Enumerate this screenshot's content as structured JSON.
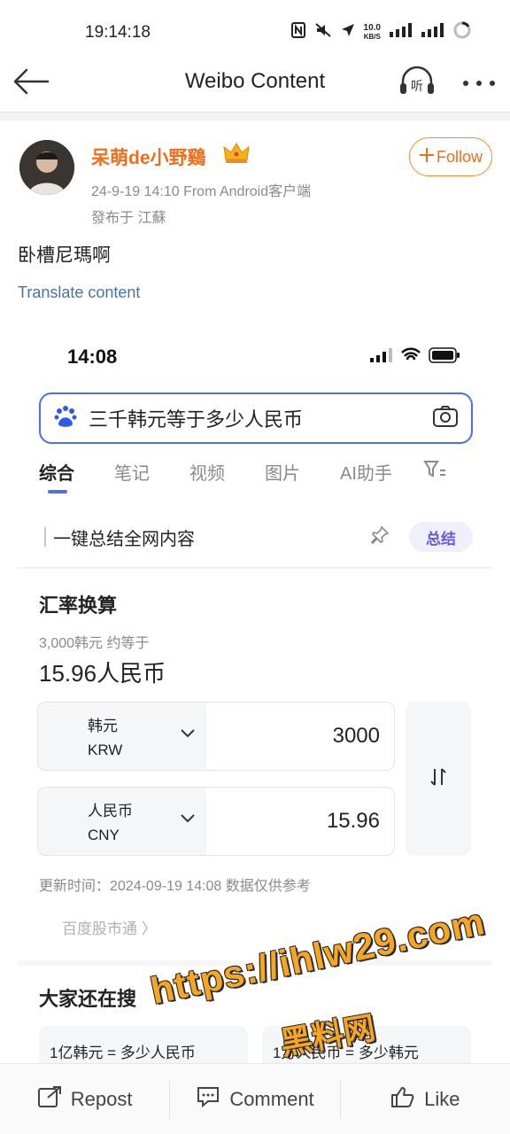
{
  "status_bar": {
    "time": "19:14:18",
    "net_speed_value": "10.0",
    "net_speed_unit": "KB/S"
  },
  "nav": {
    "title": "Weibo Content",
    "listen_label": "听"
  },
  "post": {
    "username": "呆萌de小野鷄",
    "meta": "24-9-19 14:10  From Android客户端",
    "location": "發布于 江蘇",
    "follow_label": "Follow",
    "text": "卧槽尼瑪啊",
    "translate_label": "Translate content"
  },
  "embedded": {
    "time": "14:08",
    "search_query": "三千韩元等于多少人民币",
    "tabs": [
      "综合",
      "笔记",
      "视频",
      "图片",
      "AI助手"
    ],
    "summary_text": "一键总结全网内容",
    "summary_button": "总结",
    "card_title": "汇率换算",
    "card_sub": "3,000韩元 约等于",
    "card_result": "15.96人民币",
    "from_currency": {
      "name": "韩元",
      "code": "KRW",
      "value": "3000"
    },
    "to_currency": {
      "name": "人民币",
      "code": "CNY",
      "value": "15.96"
    },
    "update_time": "更新时间：2024-09-19 14:08 数据仅供参考",
    "stock_link": "百度股市通 〉",
    "also_search_title": "大家还在搜",
    "also_search_items": [
      "1亿韩元 = 多少人民币",
      "1万人民币 = 多少韩元"
    ]
  },
  "watermark": {
    "line1": "https://ihlw29.com",
    "line2": "黑料网"
  },
  "actions": {
    "repost": "Repost",
    "comment": "Comment",
    "like": "Like"
  },
  "colors": {
    "accent": "#f26d1b",
    "link": "#4a72a8",
    "baidu_blue": "#4e6ef2"
  }
}
